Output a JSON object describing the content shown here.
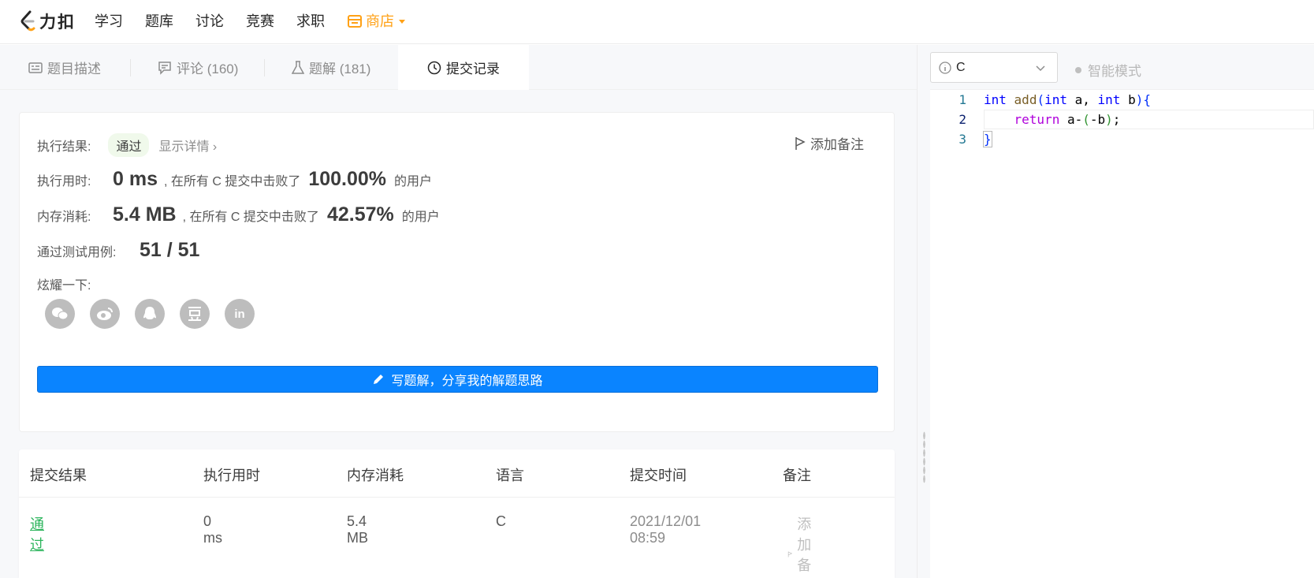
{
  "nav": {
    "brand": "力扣",
    "items": [
      "学习",
      "题库",
      "讨论",
      "竞赛",
      "求职"
    ],
    "store": "商店"
  },
  "tabs": [
    {
      "label": "题目描述",
      "icon": "description-icon"
    },
    {
      "label": "评论 (160)",
      "icon": "comment-icon"
    },
    {
      "label": "题解 (181)",
      "icon": "flask-icon"
    },
    {
      "label": "提交记录",
      "icon": "clock-icon",
      "active": true
    }
  ],
  "result": {
    "status_label": "执行结果:",
    "status": "通过",
    "details": "显示详情",
    "add_note": "添加备注",
    "runtime_label": "执行用时:",
    "runtime": "0 ms",
    "runtime_mid": ", 在所有 C 提交中击败了",
    "runtime_pct": "100.00%",
    "users_suffix": "的用户",
    "memory_label": "内存消耗:",
    "memory": "5.4 MB",
    "memory_mid": ", 在所有 C 提交中击败了",
    "memory_pct": "42.57%",
    "tests_label": "通过测试用例:",
    "tests": "51 / 51",
    "share_label": "炫耀一下:",
    "share_icons": [
      "wechat-icon",
      "weibo-icon",
      "qq-icon",
      "douban-icon",
      "linkedin-icon"
    ],
    "write_button": "写题解，分享我的解题思路"
  },
  "table": {
    "headers": [
      "提交结果",
      "执行用时",
      "内存消耗",
      "语言",
      "提交时间",
      "备注"
    ],
    "rows": [
      {
        "result": "通过",
        "runtime": "0 ms",
        "memory": "5.4 MB",
        "lang": "C",
        "time": "2021/12/01 08:59",
        "note": "添加备注"
      }
    ]
  },
  "editor": {
    "language": "C",
    "mode": "智能模式",
    "line_numbers": [
      "1",
      "2",
      "3"
    ]
  },
  "colors": {
    "accent": "#0a84ff",
    "pass": "#2db55d",
    "store": "#ffa116"
  }
}
